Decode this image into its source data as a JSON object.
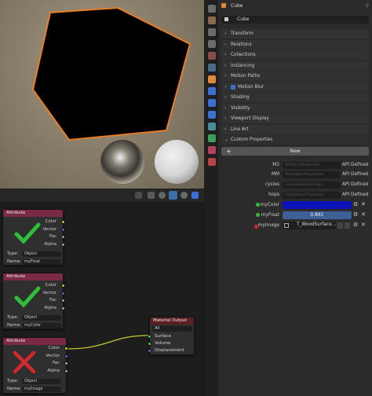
{
  "object_header": {
    "name": "Cube"
  },
  "object_field": {
    "value": "Cube"
  },
  "panels": [
    {
      "label": "Transform"
    },
    {
      "label": "Relations"
    },
    {
      "label": "Collections"
    },
    {
      "label": "Instancing"
    },
    {
      "label": "Motion Paths"
    },
    {
      "label": "Motion Blur"
    },
    {
      "label": "Shading"
    },
    {
      "label": "Visibility"
    },
    {
      "label": "Viewport Display"
    },
    {
      "label": "Line Art"
    },
    {
      "label": "Custom Properties"
    }
  ],
  "custom_properties": {
    "new_button": "New",
    "props": [
      {
        "name": "M3",
        "field": "M3ObjectProperties",
        "api": "API Defined"
      },
      {
        "name": "MM",
        "field": "MaskObjectProperties",
        "api": "API Defined"
      },
      {
        "name": "cycles",
        "field": "CyclesObjectSettings",
        "api": "API Defined"
      },
      {
        "name": "hops",
        "field": "HOpsObjectProperties",
        "api": "API Defined"
      }
    ],
    "my_color": {
      "name": "myColor",
      "color": "#0b12b8"
    },
    "my_float": {
      "name": "myFloat",
      "value": "0.861"
    },
    "my_image": {
      "name": "myImage",
      "value": "T_WoodSurface..."
    }
  },
  "nodes": {
    "attr1": {
      "title": "Attribute",
      "outputs": [
        "Color",
        "Vector",
        "Fac",
        "Alpha"
      ],
      "type_label": "Type:",
      "type_value": "Object",
      "name_label": "Name:",
      "name_value": "myFloat",
      "status": "check"
    },
    "attr2": {
      "title": "Attribute",
      "outputs": [
        "Color",
        "Vector",
        "Fac",
        "Alpha"
      ],
      "type_label": "Type:",
      "type_value": "Object",
      "name_label": "Name:",
      "name_value": "myColor",
      "status": "check"
    },
    "attr3": {
      "title": "Attribute",
      "outputs": [
        "Color",
        "Vector",
        "Fac",
        "Alpha"
      ],
      "type_label": "Type:",
      "type_value": "Object",
      "name_label": "Name:",
      "name_value": "myImage",
      "status": "cross"
    },
    "material_output": {
      "title": "Material Output",
      "target": "All",
      "inputs": [
        "Surface",
        "Volume",
        "Displacement"
      ]
    }
  },
  "colors": {
    "accent": "#e97e2a",
    "check": "#2fbf3a",
    "cross": "#d22a2a",
    "node_header": "#7a2a44"
  }
}
